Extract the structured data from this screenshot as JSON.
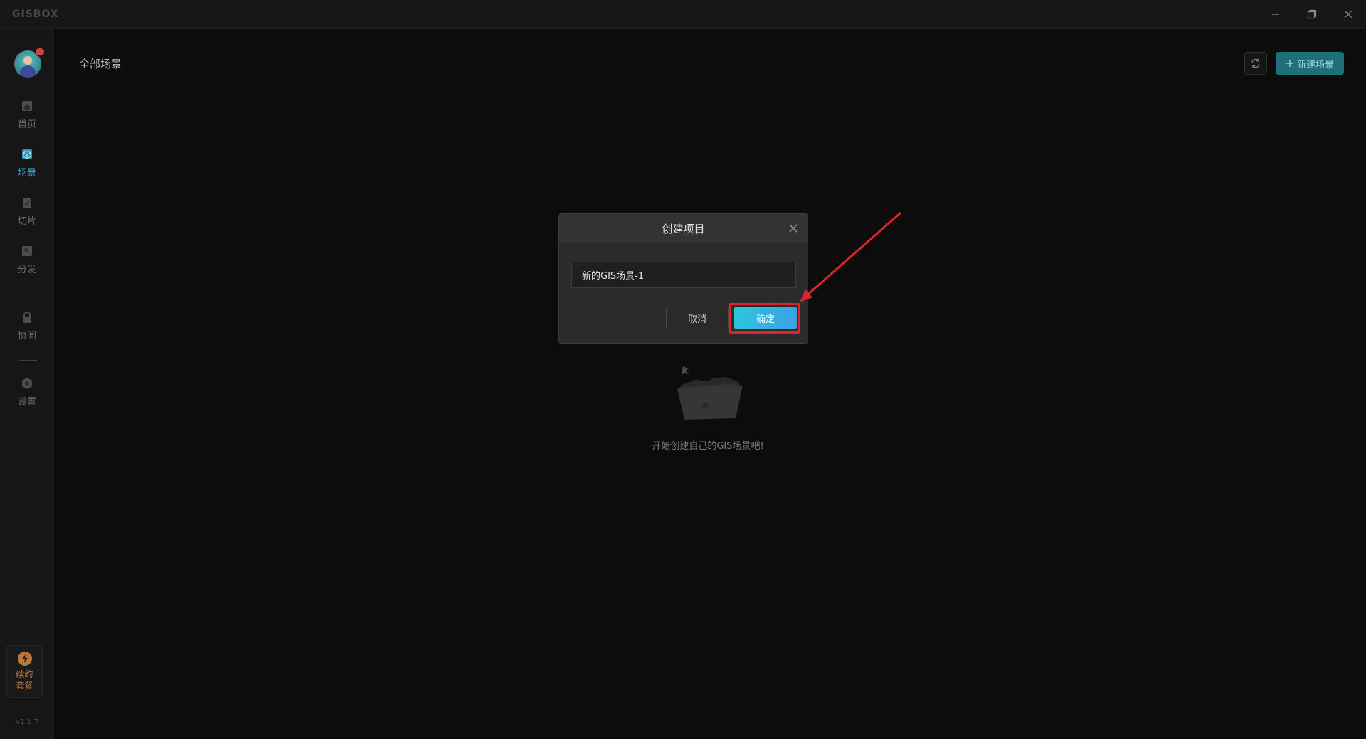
{
  "app": {
    "logo": "GISBOX"
  },
  "window_controls": {
    "minimize": "minimize-icon",
    "restore": "restore-icon",
    "close": "close-icon"
  },
  "sidebar": {
    "items": [
      {
        "label": "首页",
        "icon": "home-icon",
        "active": false
      },
      {
        "label": "场景",
        "icon": "cube-icon",
        "active": true
      },
      {
        "label": "切片",
        "icon": "slice-doc-icon",
        "active": false
      },
      {
        "label": "分发",
        "icon": "distribute-icon",
        "active": false
      },
      {
        "label": "协同",
        "icon": "lock-icon",
        "active": false
      },
      {
        "label": "设置",
        "icon": "settings-icon",
        "active": false
      }
    ],
    "renew_label": "续约套餐",
    "version": "v1.1.7"
  },
  "main": {
    "title": "全部场景",
    "new_button": "新建场景",
    "empty_text": "开始创建自己的GIS场景吧!"
  },
  "dialog": {
    "title": "创建项目",
    "input_value": "新的GIS场景-1",
    "cancel_label": "取消",
    "ok_label": "确定"
  },
  "colors": {
    "accent": "#2cc7d9",
    "active_nav": "#3aa6c6",
    "annotation_red": "#e0242f",
    "renew": "#b9773e"
  }
}
